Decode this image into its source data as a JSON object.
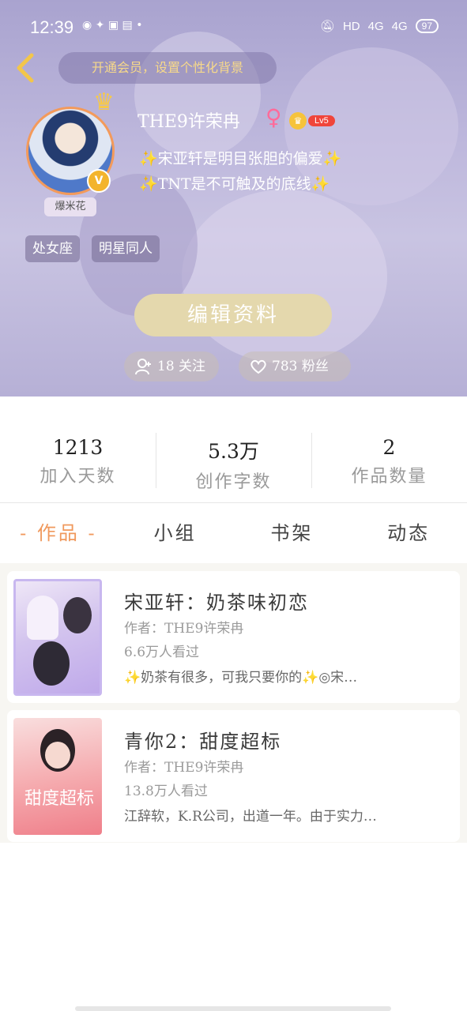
{
  "status_bar": {
    "time": "12:39",
    "network": "HD",
    "signal1": "4G",
    "signal2": "4G",
    "battery": "97"
  },
  "header": {
    "vip_prompt": "开通会员，设置个性化背景"
  },
  "profile": {
    "avatar_label": "爆米花",
    "username": "THE9许荣冉",
    "gender_symbol": "♀",
    "level": "Lv5",
    "bio_line1": "✨宋亚轩是明目张胆的偏爱✨",
    "bio_line2": "✨TNT是不可触及的底线✨",
    "tags": [
      "处女座",
      "明星同人"
    ],
    "edit_button": "编辑资料",
    "follow_label": "18 关注",
    "fans_label": "783 粉丝"
  },
  "stats": [
    {
      "value": "1213",
      "label": "加入天数"
    },
    {
      "value": "5.3万",
      "label": "创作字数"
    },
    {
      "value": "2",
      "label": "作品数量"
    }
  ],
  "tabs": [
    {
      "label": "- 作品 -",
      "active": true
    },
    {
      "label": "小组",
      "active": false
    },
    {
      "label": "书架",
      "active": false
    },
    {
      "label": "动态",
      "active": false
    }
  ],
  "works": [
    {
      "title": "宋亚轩：奶茶味初恋",
      "author": "作者：THE9许荣冉",
      "views": "6.6万人看过",
      "desc": "✨奶茶有很多，可我只要你的✨◎宋…"
    },
    {
      "title": "青你2：甜度超标",
      "author": "作者：THE9许荣冉",
      "views": "13.8万人看过",
      "desc": "江辞软，K.R公司，出道一年。由于实力…",
      "cover_text": "甜度超标"
    }
  ],
  "colors": {
    "accent_orange": "#f0995d",
    "edit_button": "#e4d8ad",
    "level_badge": "#f0453a"
  }
}
